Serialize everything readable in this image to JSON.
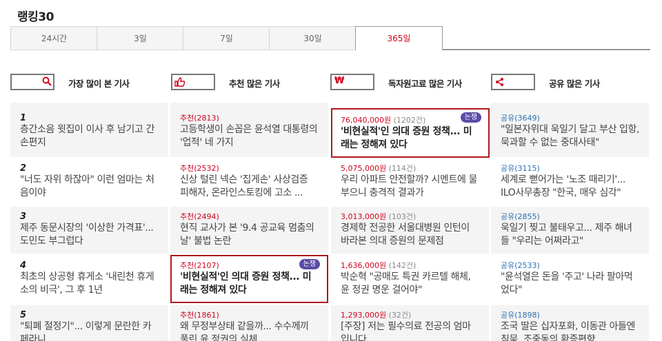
{
  "page": {
    "title": "랭킹30"
  },
  "tabs": [
    {
      "label": "24시간"
    },
    {
      "label": "3일"
    },
    {
      "label": "7일"
    },
    {
      "label": "30일"
    },
    {
      "label": "365일",
      "active": true
    }
  ],
  "columns": [
    {
      "label": "가장 많이 본 기사",
      "icon": "search-icon"
    },
    {
      "label": "추천 많은 기사",
      "icon": "thumbs-up-icon"
    },
    {
      "label": "독자원고료 많은 기사",
      "icon": "won-icon"
    },
    {
      "label": "공유 많은 기사",
      "icon": "share-icon"
    }
  ],
  "badge_text": "논쟁",
  "rows": [
    {
      "num": "1",
      "most_viewed": "층간소음 윗집이 이사 후 남기고 간 손편지",
      "recommended": {
        "meta": "추천(2813)",
        "title": "고등학생이 손꼽은 윤석열 대통령의 '업적' 네 가지"
      },
      "donation": {
        "amount": "76,040,000원",
        "count": "(1202건)",
        "title": "'비현실적'인 의대 증원 정책... 미래는 정해져 있다"
      },
      "shared": {
        "meta": "공유(3649)",
        "title": "\"일본자위대 욱일기 달고 부산 입항, 묵과할 수 없는 중대사태\""
      }
    },
    {
      "num": "2",
      "most_viewed": "\"너도 자위 하잖아\" 이런 엄마는 처음이야",
      "recommended": {
        "meta": "추천(2532)",
        "title": "신상 털린 넥슨 '집게손' 사상검증 피해자, 온라인스토킹에 고소 ..."
      },
      "donation": {
        "amount": "5,075,000원",
        "count": "(114건)",
        "title": "우리 아파트 안전할까? 시멘트에 물 부으니 충격적 결과가"
      },
      "shared": {
        "meta": "공유(3115)",
        "title": "세계로 뻗어가는 '노조 때리기'... ILO사무총장 \"한국, 매우 심각\""
      }
    },
    {
      "num": "3",
      "most_viewed": "제주 동문시장의 '이상한 가격표'... 도민도 부그럽다",
      "recommended": {
        "meta": "추천(2494)",
        "title": "현직 교사가 본 '9.4 공교육 멈춤의 날' 불법 논란"
      },
      "donation": {
        "amount": "3,013,000원",
        "count": "(103건)",
        "title": "경제학 전공한 서울대병원 인턴이 바라본 의대 증원의 문제점"
      },
      "shared": {
        "meta": "공유(2855)",
        "title": "욱일기 찢고 불태우고... 제주 해녀들 \"우리는 어쩌라고\""
      }
    },
    {
      "num": "4",
      "most_viewed": "최초의 상공형 휴게소 '내린천 휴게소의 비극', 그 후 1년",
      "recommended": {
        "meta": "추천(2107)",
        "title": "'비현실적'인 의대 증원 정책... 미래는 정해져 있다"
      },
      "donation": {
        "amount": "1,636,000원",
        "count": "(142건)",
        "title": "박순혁 \"공매도 특권 카르텔 해체, 윤 정권 명운 걸어야\""
      },
      "shared": {
        "meta": "공유(2533)",
        "title": "\"윤석열은 돈을 '주고' 나라 팔아먹었다\""
      }
    },
    {
      "num": "5",
      "most_viewed": "\"퇴폐 절정기\"... 이렇게 문란한 카페라니",
      "recommended": {
        "meta": "추천(1861)",
        "title": "왜 무정부상태 같을까... 수수께끼 풀린 윤 정권의 실체"
      },
      "donation": {
        "amount": "1,293,000원",
        "count": "(32건)",
        "title": "[주장] 저는 필수의료 전공의 엄마입니다"
      },
      "shared": {
        "meta": "공유(1898)",
        "title": "조국 딸은 십자포화, 이동관 아들엔 침묵, 조중동의 확증편향"
      }
    }
  ]
}
